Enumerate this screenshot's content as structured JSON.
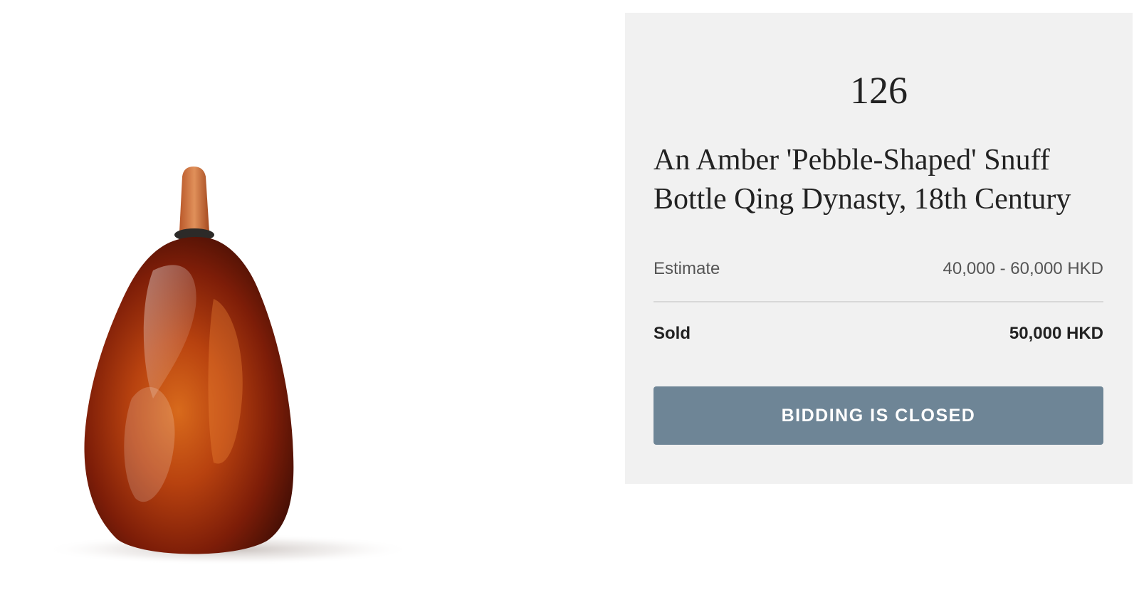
{
  "lot": {
    "number": "126",
    "title": "An Amber 'Pebble-Shaped' Snuff Bottle Qing Dynasty, 18th Century",
    "estimate_label": "Estimate",
    "estimate_value": "40,000 - 60,000 HKD",
    "sold_label": "Sold",
    "sold_value": "50,000 HKD",
    "bid_button_label": "BIDDING IS CLOSED"
  },
  "colors": {
    "panel_background": "#f1f1f1",
    "button_background": "#6e8596",
    "amber": "#8a2308"
  }
}
